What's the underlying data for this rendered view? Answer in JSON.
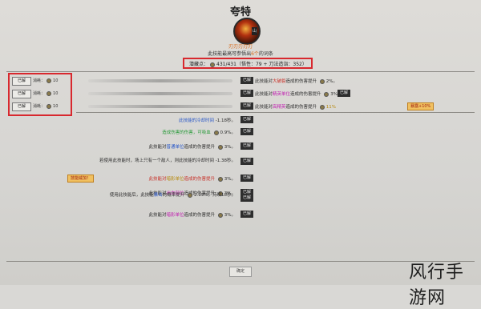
{
  "header": {
    "title": "夸特",
    "avatar_tag": "山",
    "skill_name": "刃刃刃刃刃",
    "subtitle_pre": "此技能最高可参悟出",
    "subtitle_hl": "6个",
    "subtitle_post": "的词条",
    "summary_label": "潜藏点：",
    "summary_value": "431/431（悟性：79 + 刀法造诣：352）"
  },
  "learn_rows": [
    {
      "button": "已解",
      "cost_label": "消耗：",
      "cost": "10"
    },
    {
      "button": "已解",
      "cost_label": "消耗：",
      "cost": "10"
    },
    {
      "button": "已解",
      "cost_label": "消耗：",
      "cost": "10"
    }
  ],
  "row_right": [
    {
      "tag": "已解",
      "pre": "此技能对",
      "hl": "大破裂",
      "post": "造成的伤害提升",
      "val": "2%。",
      "tail": "已解"
    },
    {
      "tag": "已解",
      "pre": "此技能对",
      "hl": "精英单位",
      "post": "造成的伤害提升",
      "val": "3%。",
      "tail": "已解"
    },
    {
      "tag": "已解",
      "pre": "此技能对",
      "hl": "高精英",
      "post": "造成的伤害提升",
      "val": "11%",
      "tail": "",
      "badge": "暴露+10%"
    }
  ],
  "effects": [
    {
      "text1": "此技能的冷却时间",
      "val": "-1.18秒。",
      "tag": "已解"
    },
    {
      "text1": "造成伤害的伤害，可吸血",
      "val": "0.9%。",
      "tag": "已解"
    },
    {
      "text1": "此技能对",
      "hl": "普通单位",
      "text2": "造成的伤害提升",
      "val": "3%。",
      "tag": "已解"
    },
    {
      "text1": "若使用此技能时，场上只有一个敌人，则此技能的冷却时间",
      "val": "-1.38秒。",
      "tag": "已解"
    },
    {
      "text1": "此技能对",
      "hl": "暗影单位",
      "text2": "造成的伤害提升",
      "val": "3%。",
      "tag": "已解",
      "badge": "技能威加！"
    },
    {
      "text1": "此技能对",
      "hl": "出血部位",
      "text2": "造成的伤害提升",
      "val": "3%。",
      "tag": "已解"
    },
    {
      "text1": "使用此技能后，此技能",
      "hl": "暴击",
      "text2": "的概率提升",
      "val": "2.19%，持续18秒。",
      "tag": "已解"
    },
    {
      "text1": "此技能对",
      "hl": "暗影单位",
      "text2": "造成的伤害提升",
      "val": "3%。",
      "tag": "已解"
    }
  ],
  "footer": {
    "confirm": "确定",
    "watermark": "风行手游网"
  }
}
